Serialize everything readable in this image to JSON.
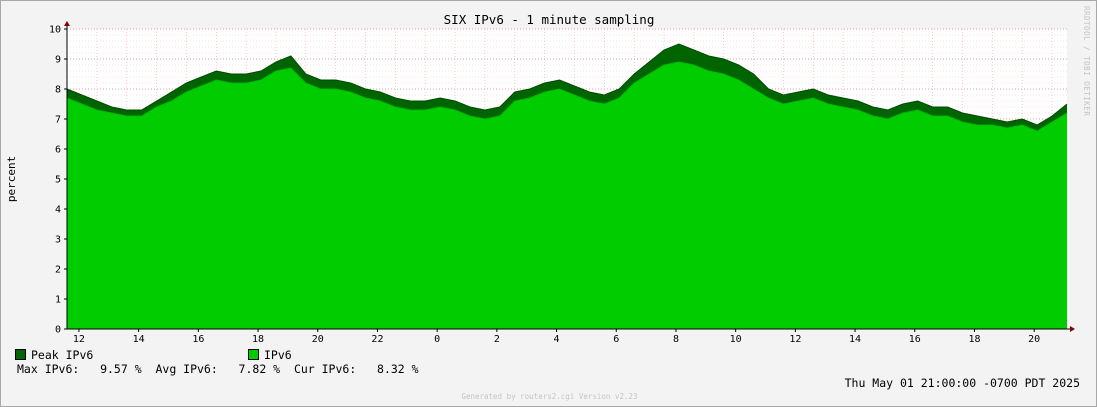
{
  "chart_data": {
    "type": "area",
    "title": "SIX IPv6 - 1 minute sampling",
    "ylabel": "percent",
    "xlabel": "",
    "ylim": [
      0,
      10
    ],
    "yticks": [
      "0",
      "1",
      "2",
      "3",
      "4",
      "5",
      "6",
      "7",
      "8",
      "9",
      "10"
    ],
    "xticks": [
      "12",
      "14",
      "16",
      "18",
      "20",
      "22",
      "0",
      "2",
      "4",
      "6",
      "8",
      "10",
      "12",
      "14",
      "16",
      "18",
      "20"
    ],
    "grid": true,
    "legend_position": "bottom-left",
    "x_hours_from_start": [
      0,
      0.5,
      1,
      1.5,
      2,
      2.5,
      3,
      3.5,
      4,
      4.5,
      5,
      5.5,
      6,
      6.5,
      7,
      7.5,
      8,
      8.5,
      9,
      9.5,
      10,
      10.5,
      11,
      11.5,
      12,
      12.5,
      13,
      13.5,
      14,
      14.5,
      15,
      15.5,
      16,
      16.5,
      17,
      17.5,
      18,
      18.5,
      19,
      19.5,
      20,
      20.5,
      21,
      21.5,
      22,
      22.5,
      23,
      23.5,
      24,
      24.5,
      25,
      25.5,
      26,
      26.5,
      27,
      27.5,
      28,
      28.5,
      29,
      29.5,
      30,
      30.5,
      31,
      31.5,
      32,
      32.5,
      33,
      33.5
    ],
    "series": [
      {
        "name": "Peak IPv6",
        "color": "#006400",
        "values": [
          8.0,
          7.8,
          7.6,
          7.4,
          7.3,
          7.3,
          7.6,
          7.9,
          8.2,
          8.4,
          8.6,
          8.5,
          8.5,
          8.6,
          8.9,
          9.1,
          8.5,
          8.3,
          8.3,
          8.2,
          8.0,
          7.9,
          7.7,
          7.6,
          7.6,
          7.7,
          7.6,
          7.4,
          7.3,
          7.4,
          7.9,
          8.0,
          8.2,
          8.3,
          8.1,
          7.9,
          7.8,
          8.0,
          8.5,
          8.9,
          9.3,
          9.5,
          9.3,
          9.1,
          9.0,
          8.8,
          8.5,
          8.0,
          7.8,
          7.9,
          8.0,
          7.8,
          7.7,
          7.6,
          7.4,
          7.3,
          7.5,
          7.6,
          7.4,
          7.4,
          7.2,
          7.1,
          7.0,
          6.9,
          7.0,
          6.8,
          7.1,
          7.5
        ]
      },
      {
        "name": "IPv6",
        "color": "#00cc00",
        "values": [
          7.7,
          7.5,
          7.3,
          7.2,
          7.1,
          7.1,
          7.4,
          7.6,
          7.9,
          8.1,
          8.3,
          8.2,
          8.2,
          8.3,
          8.6,
          8.7,
          8.2,
          8.0,
          8.0,
          7.9,
          7.7,
          7.6,
          7.4,
          7.3,
          7.3,
          7.4,
          7.3,
          7.1,
          7.0,
          7.1,
          7.6,
          7.7,
          7.9,
          8.0,
          7.8,
          7.6,
          7.5,
          7.7,
          8.2,
          8.5,
          8.8,
          8.9,
          8.8,
          8.6,
          8.5,
          8.3,
          8.0,
          7.7,
          7.5,
          7.6,
          7.7,
          7.5,
          7.4,
          7.3,
          7.1,
          7.0,
          7.2,
          7.3,
          7.1,
          7.1,
          6.9,
          6.8,
          6.8,
          6.7,
          6.8,
          6.6,
          6.9,
          7.2
        ]
      }
    ]
  },
  "legend": {
    "peak_label": "Peak IPv6",
    "avg_label": "IPv6",
    "peak_color": "#006400",
    "avg_color": "#00cc00"
  },
  "stats": {
    "line": "Max IPv6:   9.57 %  Avg IPv6:   7.82 %  Cur IPv6:   8.32 %"
  },
  "footer": {
    "timestamp": "Thu May 01 21:00:00 -0700 PDT 2025",
    "generated": "Generated by routers2.cgi Version v2.23"
  },
  "watermark": "RRDTOOL / TOBI OETIKER"
}
